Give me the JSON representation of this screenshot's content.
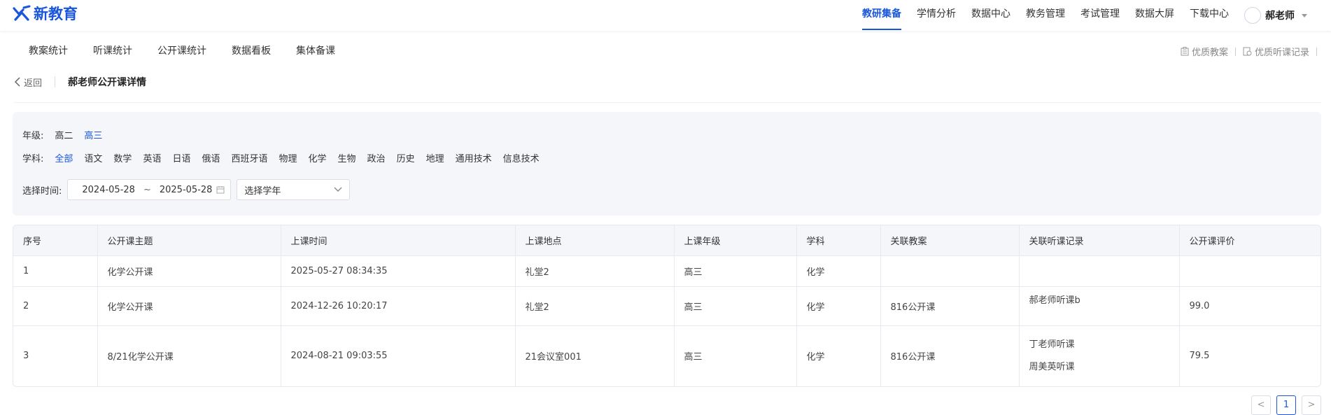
{
  "brand": {
    "name": "新教育",
    "accent": "#1a56db"
  },
  "topnav": {
    "items": [
      {
        "label": "教研集备",
        "active": true
      },
      {
        "label": "学情分析"
      },
      {
        "label": "数据中心"
      },
      {
        "label": "教务管理"
      },
      {
        "label": "考试管理"
      },
      {
        "label": "数据大屏"
      },
      {
        "label": "下载中心"
      }
    ],
    "user": "郝老师"
  },
  "subnav": {
    "items": [
      "教案统计",
      "听课统计",
      "公开课统计",
      "数据看板",
      "集体备课"
    ],
    "links": [
      "优质教案",
      "优质听课记录"
    ]
  },
  "breadcrumb": {
    "back": "返回",
    "title": "郝老师公开课详情"
  },
  "filters": {
    "grade_label": "年级:",
    "grades": [
      "高二",
      "高三"
    ],
    "grade_selected": "高三",
    "subject_label": "学科:",
    "subjects": [
      "全部",
      "语文",
      "数学",
      "英语",
      "日语",
      "俄语",
      "西班牙语",
      "物理",
      "化学",
      "生物",
      "政治",
      "历史",
      "地理",
      "通用技术",
      "信息技术"
    ],
    "subject_selected": "全部",
    "time_label": "选择时间:",
    "date_start": "2024-05-28",
    "date_sep": "~",
    "date_end": "2025-05-28",
    "year_placeholder": "选择学年"
  },
  "table": {
    "headers": [
      "序号",
      "公开课主题",
      "上课时间",
      "上课地点",
      "上课年级",
      "学科",
      "关联教案",
      "关联听课记录",
      "公开课评价"
    ],
    "rows": [
      {
        "no": "1",
        "topic": "化学公开课",
        "time": "2025-05-27 08:34:35",
        "place": "礼堂2",
        "grade": "高三",
        "subject": "化学",
        "plan": "",
        "records": [],
        "score": ""
      },
      {
        "no": "2",
        "topic": "化学公开课",
        "time": "2024-12-26 10:20:17",
        "place": "礼堂2",
        "grade": "高三",
        "subject": "化学",
        "plan": "816公开课",
        "records": [
          "郝老师听课b"
        ],
        "score": "99.0"
      },
      {
        "no": "3",
        "topic": "8/21化学公开课",
        "time": "2024-08-21 09:03:55",
        "place": "21会议室001",
        "grade": "高三",
        "subject": "化学",
        "plan": "816公开课",
        "records": [
          "丁老师听课",
          "周美英听课"
        ],
        "score": "79.5"
      }
    ]
  },
  "pagination": {
    "prev": "<",
    "current": "1",
    "next": ">"
  }
}
